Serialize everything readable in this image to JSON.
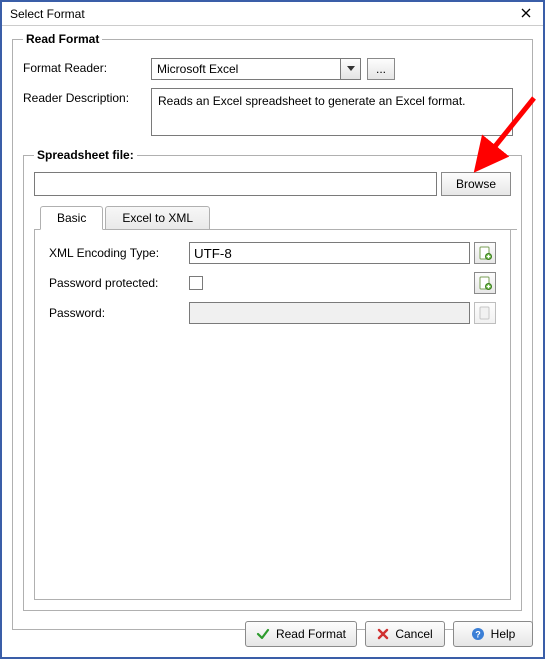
{
  "window": {
    "title": "Select Format",
    "close": "✕"
  },
  "read_format": {
    "legend": "Read Format",
    "reader_label": "Format Reader:",
    "reader_value": "Microsoft Excel",
    "ellipsis": "...",
    "desc_label": "Reader Description:",
    "desc_value": "Reads an Excel spreadsheet to generate an Excel format."
  },
  "spreadsheet": {
    "legend": "Spreadsheet file:",
    "file_value": "",
    "browse_label": "Browse"
  },
  "tabs": {
    "basic": "Basic",
    "excel_to_xml": "Excel to XML"
  },
  "basic": {
    "xml_encoding_label": "XML Encoding Type:",
    "xml_encoding_value": "UTF-8",
    "password_protected_label": "Password protected:",
    "password_protected_checked": false,
    "password_label": "Password:",
    "password_value": ""
  },
  "buttons": {
    "read_format": "Read Format",
    "cancel": "Cancel",
    "help": "Help"
  },
  "icons": {
    "page_add": "page-add-icon",
    "page_gray": "page-gray-icon",
    "check_green": "check-green-icon",
    "cancel_red": "cancel-red-icon",
    "help_blue": "help-blue-icon"
  }
}
